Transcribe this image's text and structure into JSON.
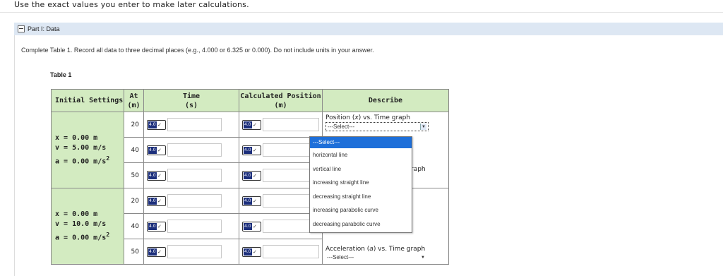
{
  "page": {
    "intro": "Use the exact values you enter to make later calculations.",
    "part_title": "Part I: Data",
    "instructions": "Complete Table 1. Record all data to three decimal places (e.g., 4.000 or 6.325 or 0.000). Do not include units in your answer.",
    "table_caption": "Table 1"
  },
  "table": {
    "headers": {
      "settings": "Initial Settings",
      "at_line1": "At",
      "at_line2": "(m)",
      "time_line1": "Time",
      "time_line2": "(s)",
      "pos_line1": "Calculated Position",
      "pos_line2": "(m)",
      "describe": "Describe"
    },
    "groups": [
      {
        "x": "x = 0.00 m",
        "v": "v = 5.00 m/s",
        "a": "a = 0.00 m/s",
        "a_exp": "2",
        "rows": [
          {
            "at": "20",
            "time_badge": "4.0",
            "pos_badge": "4.0"
          },
          {
            "at": "40",
            "time_badge": "4.0",
            "pos_badge": "4.0"
          },
          {
            "at": "50",
            "time_badge": "4.0",
            "pos_badge": "4.0"
          }
        ]
      },
      {
        "x": "x = 0.00 m",
        "v": "v = 10.0 m/s",
        "a": "a = 0.00 m/s",
        "a_exp": "2",
        "rows": [
          {
            "at": "20",
            "time_badge": "4.0",
            "pos_badge": "4.0"
          },
          {
            "at": "40",
            "time_badge": "4.0",
            "pos_badge": "4.0"
          },
          {
            "at": "50",
            "time_badge": "4.0",
            "pos_badge": "4.0"
          }
        ]
      }
    ],
    "describe": {
      "label1_pre": "Position (",
      "label1_var": "x",
      "label1_post": ") vs. Time graph",
      "select1": "---Select---",
      "partial_right": "raph",
      "label2_pre": "Acceleration (",
      "label2_var": "a",
      "label2_post": ") vs. Time graph",
      "select2": "---Select---"
    }
  },
  "dropdown": {
    "options": [
      "---Select---",
      "horizontal line",
      "vertical line",
      "increasing straight line",
      "decreasing straight line",
      "increasing parabolic curve",
      "decreasing parabolic curve"
    ]
  },
  "colors": {
    "header_green": "#d3ebc1",
    "part_header_blue": "#dde7f3",
    "selected_option": "#1e6fd9",
    "badge_blue": "#1c2f7c"
  }
}
